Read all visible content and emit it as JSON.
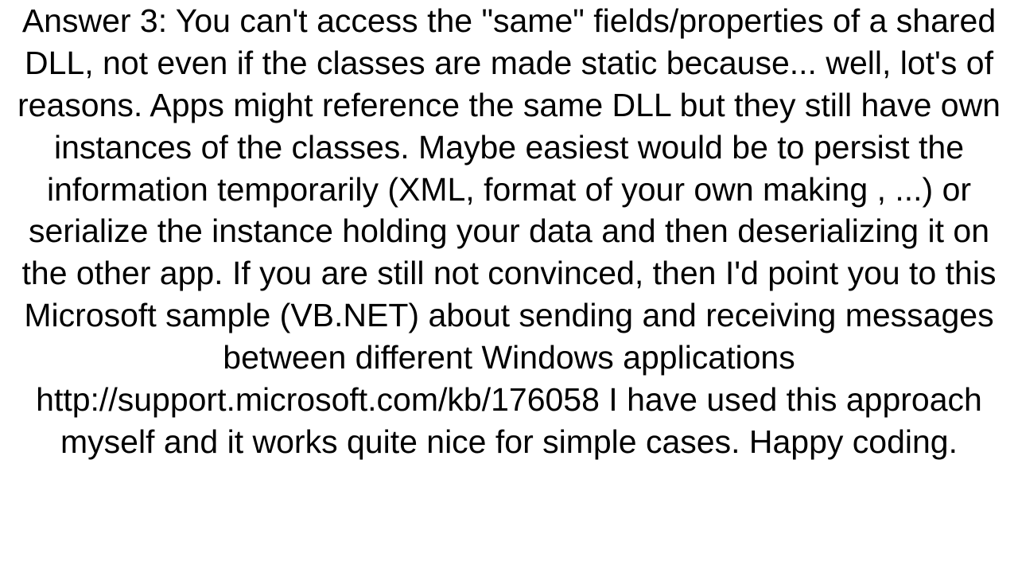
{
  "answer": {
    "text": "Answer 3: You can't access the \"same\" fields/properties of a shared DLL, not even if the classes are made static because... well, lot's of reasons. Apps might reference the same DLL but they still have own instances of the classes. Maybe easiest would be to persist the information temporarily (XML, format of your own making , ...) or serialize the instance holding your data and then deserializing it on the other app. If you are still not convinced, then I'd point you to this Microsoft sample (VB.NET) about sending and receiving messages between different Windows applications http://support.microsoft.com/kb/176058  I have used this approach myself and it works quite nice for simple cases. Happy coding."
  }
}
